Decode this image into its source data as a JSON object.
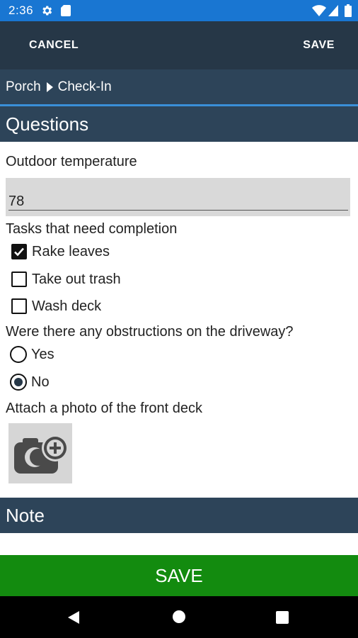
{
  "status_bar": {
    "time": "2:36",
    "icons": [
      "gear-icon",
      "sd-card-icon",
      "wifi-icon",
      "signal-icon",
      "battery-icon"
    ]
  },
  "action_bar": {
    "cancel_label": "CANCEL",
    "save_label": "SAVE"
  },
  "breadcrumb": {
    "items": [
      "Porch",
      "Check-In"
    ]
  },
  "questions_section": {
    "title": "Questions",
    "temperature": {
      "label": "Outdoor temperature",
      "value": "78"
    },
    "tasks": {
      "label": "Tasks that need completion",
      "options": [
        {
          "label": "Rake leaves",
          "checked": true
        },
        {
          "label": "Take out trash",
          "checked": false
        },
        {
          "label": "Wash deck",
          "checked": false
        }
      ]
    },
    "obstructions": {
      "label": "Were there any obstructions on the driveway?",
      "options": [
        {
          "label": "Yes",
          "selected": false
        },
        {
          "label": "No",
          "selected": true
        }
      ]
    },
    "photo": {
      "label": "Attach a photo of the front deck",
      "icon": "add-photo-camera-icon"
    }
  },
  "note_section": {
    "title": "Note"
  },
  "footer": {
    "save_label": "SAVE"
  },
  "nav_bar": {
    "icons": [
      "back-icon",
      "home-icon",
      "recent-apps-icon"
    ]
  },
  "colors": {
    "status_bar": "#1976d2",
    "action_bar": "#263747",
    "section_header": "#2d4459",
    "accent_line": "#3a8fd8",
    "save_button": "#138b0f"
  }
}
